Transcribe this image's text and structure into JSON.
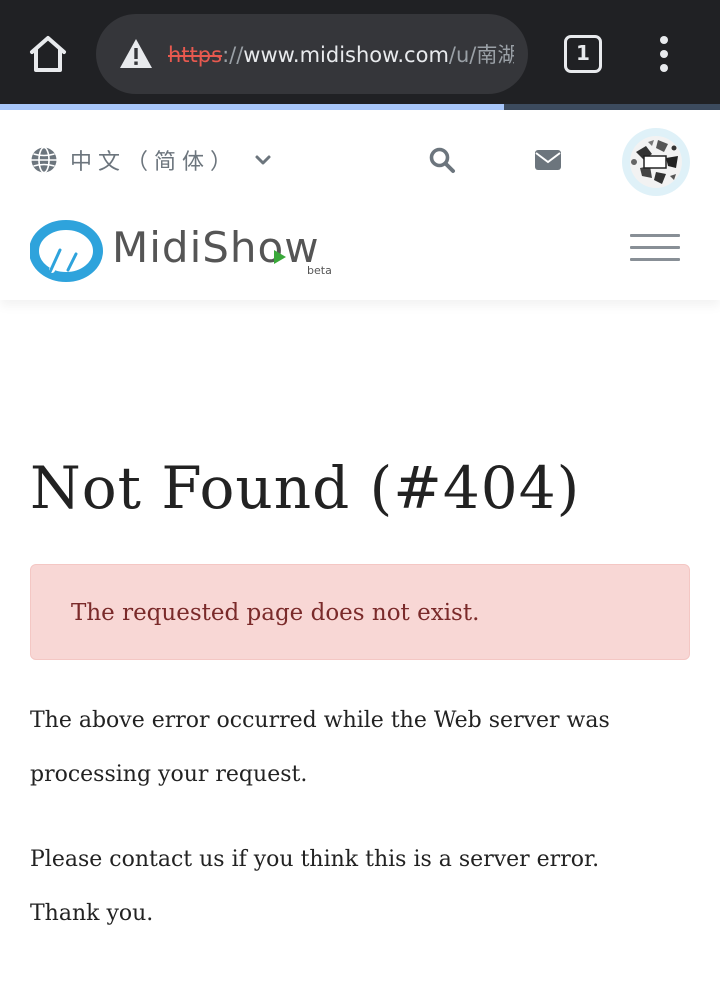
{
  "browser": {
    "url": {
      "scheme": "https",
      "separator": "://",
      "host": "www.midishow.com",
      "path": "/u/南湖"
    },
    "tab_count": "1",
    "load_progress": 0.7,
    "icons": [
      "home-icon",
      "not-secure-warning-icon",
      "tab-switcher-icon",
      "more-vert-icon"
    ]
  },
  "header": {
    "language_label": "中文（简体）",
    "icons": [
      "globe-icon",
      "chevron-down-icon",
      "search-icon",
      "mail-icon",
      "avatar",
      "hamburger-menu-icon"
    ],
    "logo": {
      "text": "MidiShow",
      "badge": "beta"
    },
    "colors": {
      "logo_blue": "#2ea3dc",
      "play_green": "#3aa83a",
      "icon_gray": "#6c757d"
    }
  },
  "main": {
    "title": "Not Found (#404)",
    "alert_message": "The requested page does not exist.",
    "paragraph_1": "The above error occurred while the Web server was processing your request.",
    "paragraph_2": "Please contact us if you think this is a server error. Thank you.",
    "colors": {
      "alert_bg": "#f8d7d5",
      "alert_text": "#7a2a2a"
    }
  }
}
